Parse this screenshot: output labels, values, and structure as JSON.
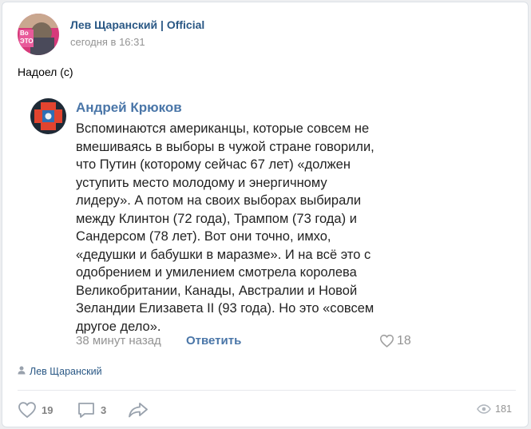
{
  "post": {
    "author": "Лев Щаранский | Official",
    "time": "сегодня в 16:31",
    "text": "Надоел (с)",
    "signer": "Лев Щаранский",
    "likes": "19",
    "comments": "3",
    "views": "181"
  },
  "quote": {
    "author": "Андрей Крюков",
    "lines": [
      "Вспоминаются американцы, которые совсем не",
      "вмешиваясь в выборы в чужой стране говорили,",
      "что Путин (которому сейчас 67 лет) «должен",
      "уступить место молодому и энергичному",
      "лидеру». А потом на своих выборах выбирали",
      "между Клинтон (72 года), Трампом (73 года) и",
      "Сандерсом (78 лет). Вот они точно, имхо,",
      "«дедушки и бабушки в маразме». И на всё это с",
      "одобрением и умилением смотрела королева",
      "Великобритании, Канады, Австралии и Новой",
      "Зеландии Елизавета II (93 года). Но это «совсем",
      "другое дело»."
    ],
    "time": "38 минут назад",
    "reply_label": "Ответить",
    "likes": "18"
  },
  "colors": {
    "link": "#2a5885",
    "accent": "#4a76a8",
    "muted": "#939393",
    "icon": "#99a2ad"
  },
  "icons": {
    "like": "heart-icon",
    "comment": "comment-icon",
    "share": "share-arrow-icon",
    "views": "eye-icon",
    "signer": "person-icon"
  }
}
